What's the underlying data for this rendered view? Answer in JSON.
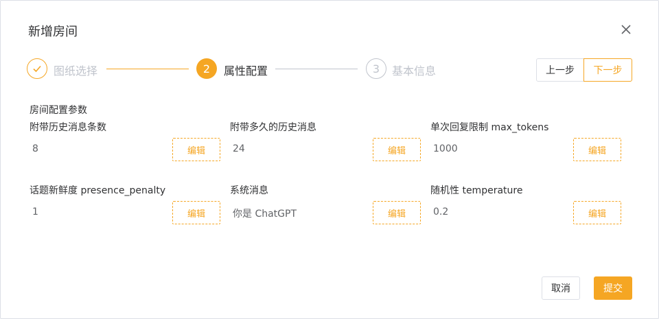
{
  "dialog": {
    "title": "新增房间",
    "close_icon": "close-icon"
  },
  "steps": [
    {
      "number": "✓",
      "label": "图纸选择",
      "status": "finished"
    },
    {
      "number": "2",
      "label": "属性配置",
      "status": "active"
    },
    {
      "number": "3",
      "label": "基本信息",
      "status": "pending"
    }
  ],
  "nav": {
    "prev_label": "上一步",
    "next_label": "下一步"
  },
  "section_title": "房间配置参数",
  "fields": [
    {
      "label": "附带历史消息条数",
      "value": "8",
      "edit_label": "编辑"
    },
    {
      "label": "附带多久的历史消息",
      "value": "24",
      "edit_label": "编辑"
    },
    {
      "label": "单次回复限制 max_tokens",
      "value": "1000",
      "edit_label": "编辑"
    },
    {
      "label": "话题新鲜度 presence_penalty",
      "value": "1",
      "edit_label": "编辑"
    },
    {
      "label": "系统消息",
      "value": "你是 ChatGPT",
      "edit_label": "编辑"
    },
    {
      "label": "随机性 temperature",
      "value": "0.2",
      "edit_label": "编辑"
    }
  ],
  "footer": {
    "cancel_label": "取消",
    "submit_label": "提交"
  },
  "colors": {
    "accent": "#f5a623",
    "muted": "#c0c4cc",
    "text": "#303133"
  }
}
